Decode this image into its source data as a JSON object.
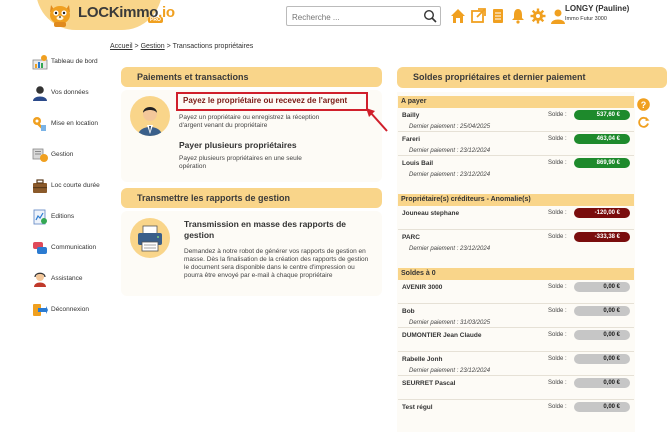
{
  "header": {
    "logo_main": "LOCKimmo",
    "logo_io": ".io",
    "logo_pro": "PRO",
    "search_placeholder": "Recherche ...",
    "user_name": "LONGY (Pauline)",
    "user_agency": "Immo Futur 3000",
    "icons": [
      "home-icon",
      "external-link-icon",
      "document-icon",
      "bell-icon",
      "gear-icon",
      "user-icon"
    ],
    "accent_color": "#f0a020"
  },
  "sidebar": {
    "items": [
      {
        "label": "Tableau de bord",
        "icon": "dashboard-icon"
      },
      {
        "label": "Vos données",
        "icon": "person-icon"
      },
      {
        "label": "Mise en location",
        "icon": "key-icon"
      },
      {
        "label": "Gestion",
        "icon": "management-icon"
      },
      {
        "label": "Loc courte durée",
        "icon": "suitcase-icon"
      },
      {
        "label": "Editions",
        "icon": "editions-icon"
      },
      {
        "label": "Communication",
        "icon": "chat-icon"
      },
      {
        "label": "Assistance",
        "icon": "support-icon"
      },
      {
        "label": "Déconnexion",
        "icon": "logout-icon"
      }
    ]
  },
  "breadcrumb": {
    "home": "Accueil",
    "sep1": ">",
    "section": "Gestion",
    "sep2": ">",
    "current": "Transactions propriétaires"
  },
  "payments_card": {
    "title": "Paiements et transactions",
    "link_label": "Payez le propriétaire ou recevez de l'argent",
    "link_desc": "Payez un propriétaire ou enregistrez la réception d'argent venant du propriétaire",
    "multi_title": "Payer plusieurs propriétaires",
    "multi_desc": "Payez plusieurs propriétaires en une seule opération"
  },
  "reports_card": {
    "title": "Transmettre les rapports de gestion",
    "sub_title": "Transmission en masse des rapports de gestion",
    "desc": "Demandez à notre robot de générer vos rapports de gestion en masse. Dès la finalisation de la création des rapports de gestion le document sera disponible dans le centre d'impression ou pourra être envoyé par e-mail à chaque propriétaire"
  },
  "balances": {
    "title": "Soldes propriétaires et dernier paiement",
    "solde_label": "Solde :",
    "last_payment_prefix": "Dernier paiement :",
    "sections": [
      {
        "title": "A payer",
        "color": "#1e8a2c",
        "rows": [
          {
            "name": "Bailly",
            "last_payment": "25/04/2025",
            "amount": "537,60 €"
          },
          {
            "name": "Fareri",
            "last_payment": "23/12/2024",
            "amount": "463,04 €"
          },
          {
            "name": "Louis Bail",
            "last_payment": "23/12/2024",
            "amount": "869,90 €"
          }
        ]
      },
      {
        "title": "Propriétaire(s) créditeurs - Anomalie(s)",
        "color": "#7a0d0d",
        "rows": [
          {
            "name": "Jouneau stephane",
            "last_payment": "",
            "amount": "-120,00 €"
          },
          {
            "name": "PARC",
            "last_payment": "23/12/2024",
            "amount": "-333,38 €"
          }
        ]
      },
      {
        "title": "Soldes à 0",
        "color": "#c6c6c6",
        "rows": [
          {
            "name": "AVENIR 3000",
            "last_payment": "",
            "amount": "0,00 €"
          },
          {
            "name": "Bob",
            "last_payment": "31/03/2025",
            "amount": "0,00 €"
          },
          {
            "name": "DUMONTIER Jean Claude",
            "last_payment": "",
            "amount": "0,00 €"
          },
          {
            "name": "Rabelle Jonh",
            "last_payment": "23/12/2024",
            "amount": "0,00 €"
          },
          {
            "name": "SEURRET Pascal",
            "last_payment": "",
            "amount": "0,00 €"
          },
          {
            "name": "Test régul",
            "last_payment": "",
            "amount": "0,00 €"
          }
        ]
      }
    ]
  }
}
